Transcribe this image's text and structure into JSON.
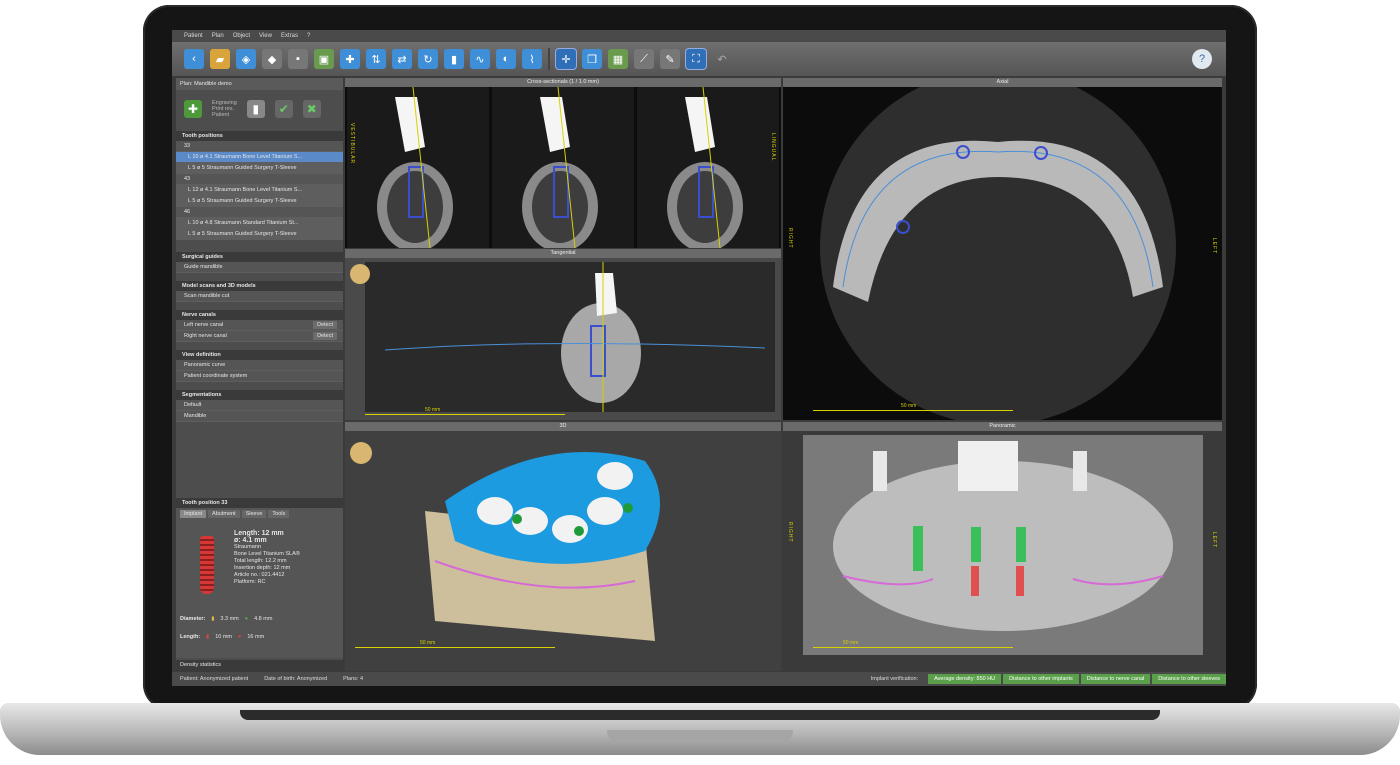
{
  "menu": [
    "Patient",
    "Plan",
    "Object",
    "View",
    "Extras",
    "?"
  ],
  "plan_header": "Plan: Mandible demo",
  "plan_tools_note": [
    "Engraving",
    "Print res.",
    "Patient"
  ],
  "sections": {
    "tooth_positions": {
      "title": "Tooth positions",
      "groups": [
        {
          "tooth": "33",
          "rows": [
            "L 10 ø 4.1  Straumann Bone Level Titanium S...",
            "L 5 ø 5  Straumann Guided Surgery T-Sleeve"
          ]
        },
        {
          "tooth": "43",
          "rows": [
            "L 12 ø 4.1  Straumann Bone Level Titanium S...",
            "L 5 ø 5  Straumann Guided Surgery T-Sleeve"
          ]
        },
        {
          "tooth": "46",
          "rows": [
            "L 10 ø 4.8  Straumann Standard Titanium St...",
            "L 5 ø 5  Straumann Guided Surgery T-Sleeve"
          ]
        }
      ]
    },
    "surgical_guides": {
      "title": "Surgical guides",
      "rows": [
        "Guide mandible"
      ]
    },
    "model_scans": {
      "title": "Model scans and 3D models",
      "rows": [
        "Scan mandible cut"
      ]
    },
    "nerve_canals": {
      "title": "Nerve canals",
      "rows": [
        "Left nerve canal",
        "Right nerve canal"
      ],
      "detect": "Detect"
    },
    "view_definition": {
      "title": "View definition",
      "rows": [
        "Panoramic curve",
        "Patient coordinate system"
      ]
    },
    "segmentations": {
      "title": "Segmentations",
      "rows": [
        "Default",
        "Mandible"
      ]
    }
  },
  "tooth_position_panel": {
    "title": "Tooth position 33",
    "tabs": [
      "Implant",
      "Abutment",
      "Sleeve",
      "Tools"
    ],
    "length": "Length: 12 mm",
    "diameter_line": "ø: 4.1 mm",
    "details": [
      "Straumann",
      "Bone Level Titanium SLA®",
      "Total length: 12.2 mm",
      "Insertion depth: 12 mm",
      "Article no.: 021.4412",
      "Platform: RC"
    ],
    "diameter_label": "Diameter:",
    "length_label": "Length:",
    "d1": "3.3 mm",
    "d2": "4.8 mm",
    "l1": "10 mm",
    "l2": "16 mm"
  },
  "density_label": "Density statistics",
  "views": {
    "cross": "Cross-sectionals (1 / 1.0 mm)",
    "axial": "Axial",
    "tangential": "Tangential",
    "threed": "3D",
    "pano": "Panoramic",
    "scale": "50 mm",
    "vest": "VESTIBULAR",
    "ling": "LINGUAL",
    "right": "RIGHT",
    "left": "LEFT"
  },
  "status": {
    "patient": "Patient: Anonymized patient",
    "dob": "Date of birth: Anonymized",
    "plans": "Plans: 4",
    "verif": "Implant verification:",
    "badges": [
      "Average density: 850 HU",
      "Distance to other implants",
      "Distance to nerve canal",
      "Distance to other sleeves"
    ]
  }
}
